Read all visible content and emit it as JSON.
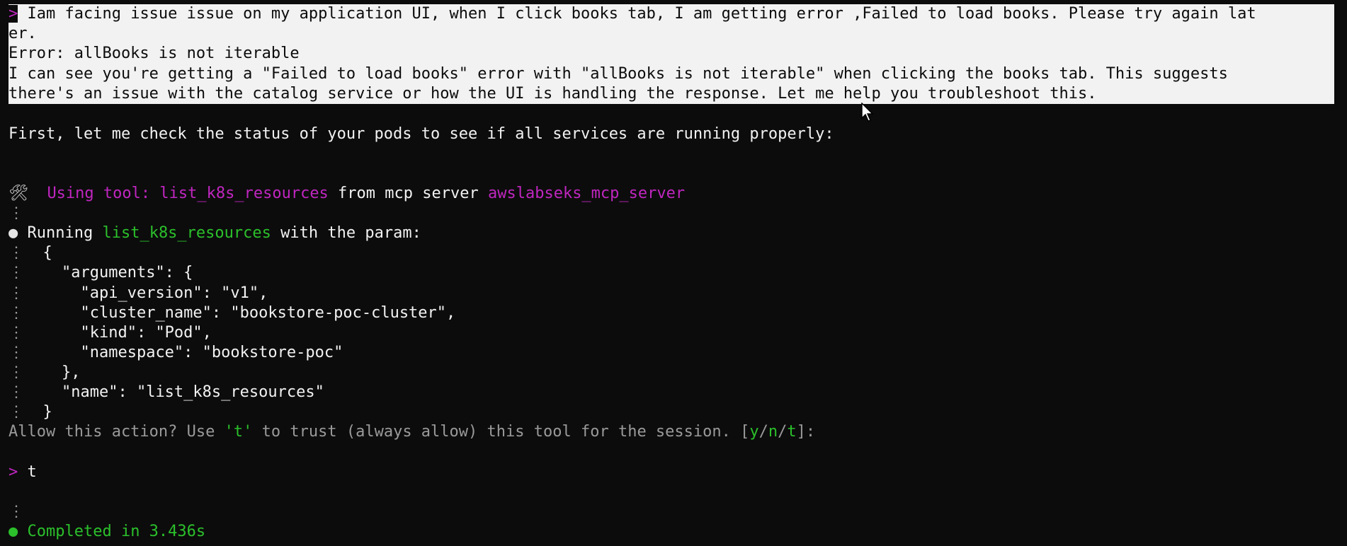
{
  "prompt_symbol": ">",
  "user_message": {
    "line1": "Iam facing issue issue on my application UI, when I click books tab, I am getting error ,Failed to load books. Please try again lat",
    "line2": "er.",
    "line3": "Error: allBooks is not iterable",
    "line4": "I can see you're getting a \"Failed to load books\" error with \"allBooks is not iterable\" when clicking the books tab. This suggests",
    "line5": "there's an issue with the catalog service or how the UI is handling the response. Let me help you troubleshoot this."
  },
  "status_check": "First, let me check the status of your pods to see if all services are running properly:",
  "tool_use": {
    "icon": "hammer-wrench-icon",
    "glyph": "🛠",
    "prefix": "Using tool: ",
    "tool_name": "list_k8s_resources",
    "middle": " from mcp server ",
    "server_name": "awslabseks_mcp_server"
  },
  "running": {
    "bullet": "●",
    "prefix": "Running ",
    "tool_name": "list_k8s_resources",
    "suffix": " with the param:"
  },
  "params_lines": [
    "{",
    "  \"arguments\": {",
    "    \"api_version\": \"v1\",",
    "    \"cluster_name\": \"bookstore-poc-cluster\",",
    "    \"kind\": \"Pod\",",
    "    \"namespace\": \"bookstore-poc\"",
    "  },",
    "  \"name\": \"list_k8s_resources\"",
    "}"
  ],
  "dots_glyph": "⋮",
  "allow": {
    "prefix": "Allow this action? Use ",
    "quote_t": "'t'",
    "middle": " to trust (always allow) this tool for the session. [",
    "y": "y",
    "slash1": "/",
    "n": "n",
    "slash2": "/",
    "t": "t",
    "suffix": "]:"
  },
  "user_reply": "t",
  "completed": {
    "bullet": "●",
    "text": "Completed in 3.436s"
  },
  "colors": {
    "background": "#0c0c0c",
    "magenta": "#c026c0",
    "green": "#2bc02b",
    "selection": "#f2f2f2"
  }
}
